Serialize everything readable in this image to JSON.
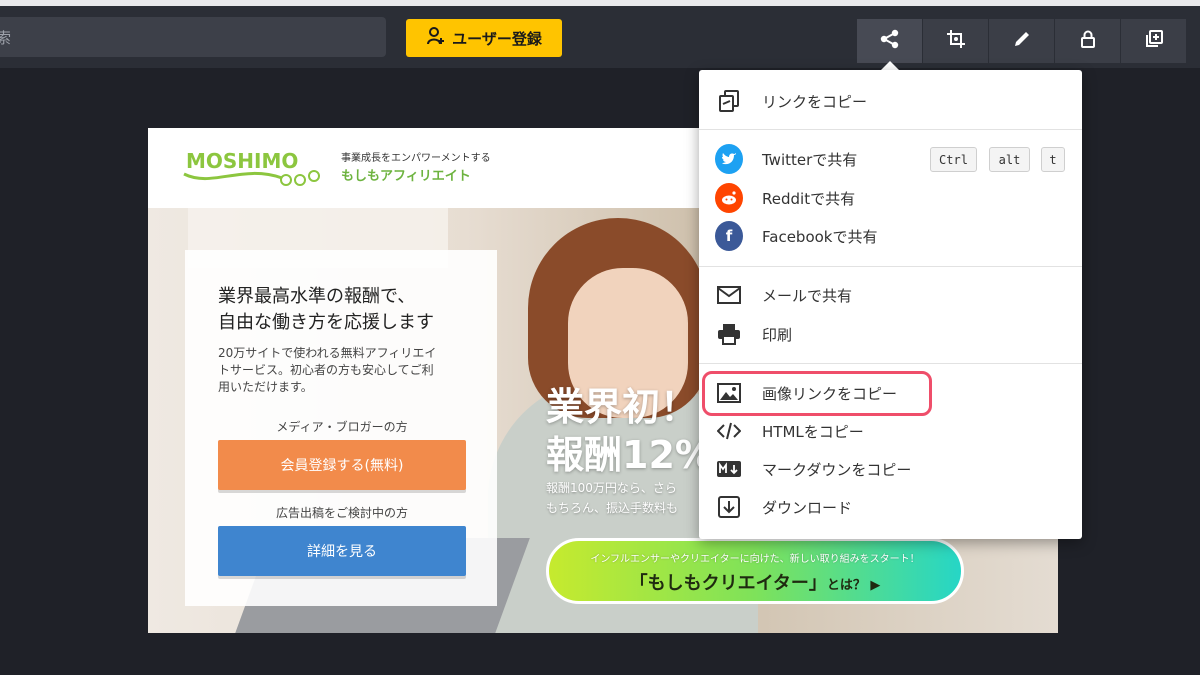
{
  "toolbar": {
    "search_text": "索",
    "register_label": "ユーザー登録",
    "register_icon": "add-user-icon",
    "tools": [
      {
        "name": "share-icon",
        "active": true
      },
      {
        "name": "crop-icon",
        "active": false
      },
      {
        "name": "pencil-icon",
        "active": false
      },
      {
        "name": "lock-icon",
        "active": false
      },
      {
        "name": "copy-layer-icon",
        "active": false
      }
    ]
  },
  "preview": {
    "logo_text": "MOSHIMO",
    "tagline": "事業成長をエンパワーメントする",
    "brand": "もしもアフィリエイト",
    "card": {
      "title_line1": "業界最高水準の報酬で、",
      "title_line2": "自由な働き方を応援します",
      "desc_line1": "20万サイトで使われる無料アフィリエイ",
      "desc_line2": "トサービス。初心者の方も安心してご利",
      "desc_line3": "用いただけます。",
      "media_label": "メディア・ブロガーの方",
      "signup_button": "会員登録する(無料)",
      "advertiser_label": "広告出稿をご検討中の方",
      "details_button": "詳細を見る"
    },
    "headline_line1": "業界初！",
    "headline_line2": "報酬12%",
    "sub_line1": "報酬100万円なら、さら",
    "sub_line2": "もちろん、振込手数料も",
    "banner_small": "インフルエンサーやクリエイターに向けた、新しい取り組みをスタート！",
    "banner_big": "「もしもクリエイター」",
    "banner_suffix": "とは？ ▶"
  },
  "share_menu": {
    "items": [
      {
        "icon": "copy-link-icon",
        "label": "リンクをコピー"
      },
      {
        "icon": "twitter-icon",
        "label": "Twitterで共有"
      },
      {
        "icon": "reddit-icon",
        "label": "Redditで共有"
      },
      {
        "icon": "facebook-icon",
        "label": "Facebookで共有"
      },
      {
        "icon": "mail-icon",
        "label": "メールで共有"
      },
      {
        "icon": "print-icon",
        "label": "印刷"
      },
      {
        "icon": "image-icon",
        "label": "画像リンクをコピー"
      },
      {
        "icon": "code-icon",
        "label": "HTMLをコピー"
      },
      {
        "icon": "markdown-icon",
        "label": "マークダウンをコピー"
      },
      {
        "icon": "download-icon",
        "label": "ダウンロード"
      }
    ],
    "shortcut_keys": [
      "Ctrl",
      "alt",
      "t"
    ],
    "highlighted_item": "画像リンクをコピー",
    "highlight_color": "#ef4e6a"
  },
  "colors": {
    "register_button": "#ffc400",
    "signup_button": "#f28b4b",
    "details_button": "#3f85cf",
    "twitter": "#1da1f2",
    "reddit": "#ff4500",
    "facebook": "#3b5998",
    "brand_green": "#6db33f"
  }
}
